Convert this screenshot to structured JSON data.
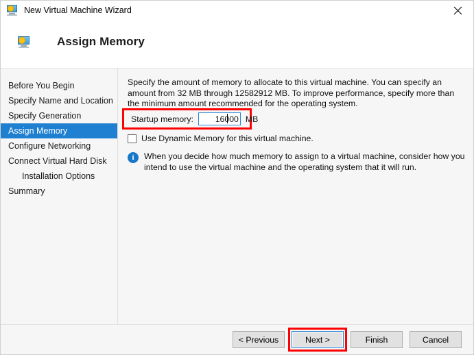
{
  "window": {
    "title": "New Virtual Machine Wizard",
    "icon": "virtual-machine-icon",
    "close_label": "✕"
  },
  "header": {
    "title": "Assign Memory",
    "icon": "virtual-machine-icon"
  },
  "sidebar": {
    "items": [
      {
        "label": "Before You Begin",
        "active": false,
        "sub": false
      },
      {
        "label": "Specify Name and Location",
        "active": false,
        "sub": false
      },
      {
        "label": "Specify Generation",
        "active": false,
        "sub": false
      },
      {
        "label": "Assign Memory",
        "active": true,
        "sub": false
      },
      {
        "label": "Configure Networking",
        "active": false,
        "sub": false
      },
      {
        "label": "Connect Virtual Hard Disk",
        "active": false,
        "sub": false
      },
      {
        "label": "Installation Options",
        "active": false,
        "sub": true
      },
      {
        "label": "Summary",
        "active": false,
        "sub": false
      }
    ]
  },
  "main": {
    "intro": "Specify the amount of memory to allocate to this virtual machine. You can specify an amount from 32 MB through 12582912 MB. To improve performance, specify more than the minimum amount recommended for the operating system.",
    "startup_memory": {
      "label": "Startup memory:",
      "value": "16000",
      "placeholder": "",
      "unit": "MB"
    },
    "dynamic_memory": {
      "label": "Use Dynamic Memory for this virtual machine.",
      "checked": false
    },
    "note": {
      "icon": "info-icon",
      "glyph": "i",
      "text": "When you decide how much memory to assign to a virtual machine, consider how you intend to use the virtual machine and the operating system that it will run."
    }
  },
  "footer": {
    "buttons": [
      {
        "label": "< Previous",
        "default": false,
        "highlighted": false
      },
      {
        "label": "Next >",
        "default": true,
        "highlighted": true
      },
      {
        "label": "Finish",
        "default": false,
        "highlighted": false
      },
      {
        "label": "Cancel",
        "default": false,
        "highlighted": false
      }
    ]
  },
  "colors": {
    "accent": "#1f7fd0",
    "annotation": "#ff0000",
    "body_background": "#f6f6f6",
    "info_icon": "#1878c8"
  }
}
